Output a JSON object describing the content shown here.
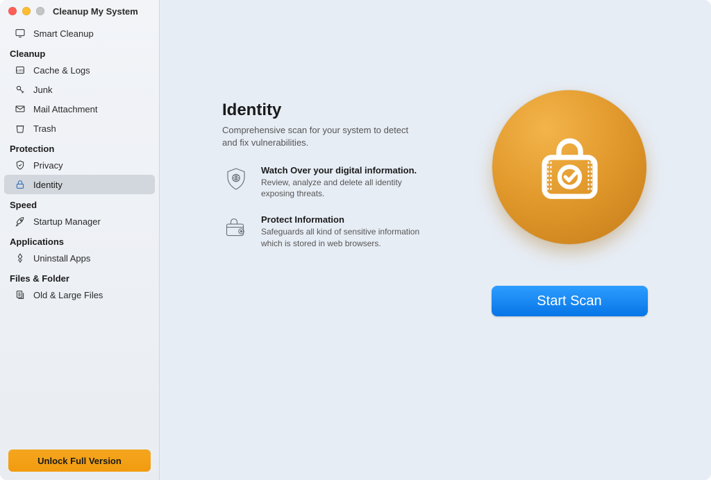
{
  "app": {
    "title": "Cleanup My System"
  },
  "sidebar": {
    "smart_cleanup": "Smart Cleanup",
    "sections": {
      "cleanup": {
        "header": "Cleanup",
        "items": {
          "cache_logs": "Cache & Logs",
          "junk": "Junk",
          "mail_attachment": "Mail Attachment",
          "trash": "Trash"
        }
      },
      "protection": {
        "header": "Protection",
        "items": {
          "privacy": "Privacy",
          "identity": "Identity"
        }
      },
      "speed": {
        "header": "Speed",
        "items": {
          "startup_manager": "Startup Manager"
        }
      },
      "applications": {
        "header": "Applications",
        "items": {
          "uninstall_apps": "Uninstall Apps"
        }
      },
      "files_folder": {
        "header": "Files & Folder",
        "items": {
          "old_large_files": "Old & Large Files"
        }
      }
    }
  },
  "unlock": {
    "label": "Unlock Full Version"
  },
  "page": {
    "title": "Identity",
    "subtitle": "Comprehensive scan for your system to detect and fix vulnerabilities.",
    "features": {
      "watch": {
        "title": "Watch Over your digital information.",
        "desc": "Review, analyze and delete all identity exposing threats."
      },
      "protect": {
        "title": "Protect Information",
        "desc": "Safeguards all kind of sensitive information which is stored in web browsers."
      }
    },
    "scan_button": "Start Scan"
  }
}
